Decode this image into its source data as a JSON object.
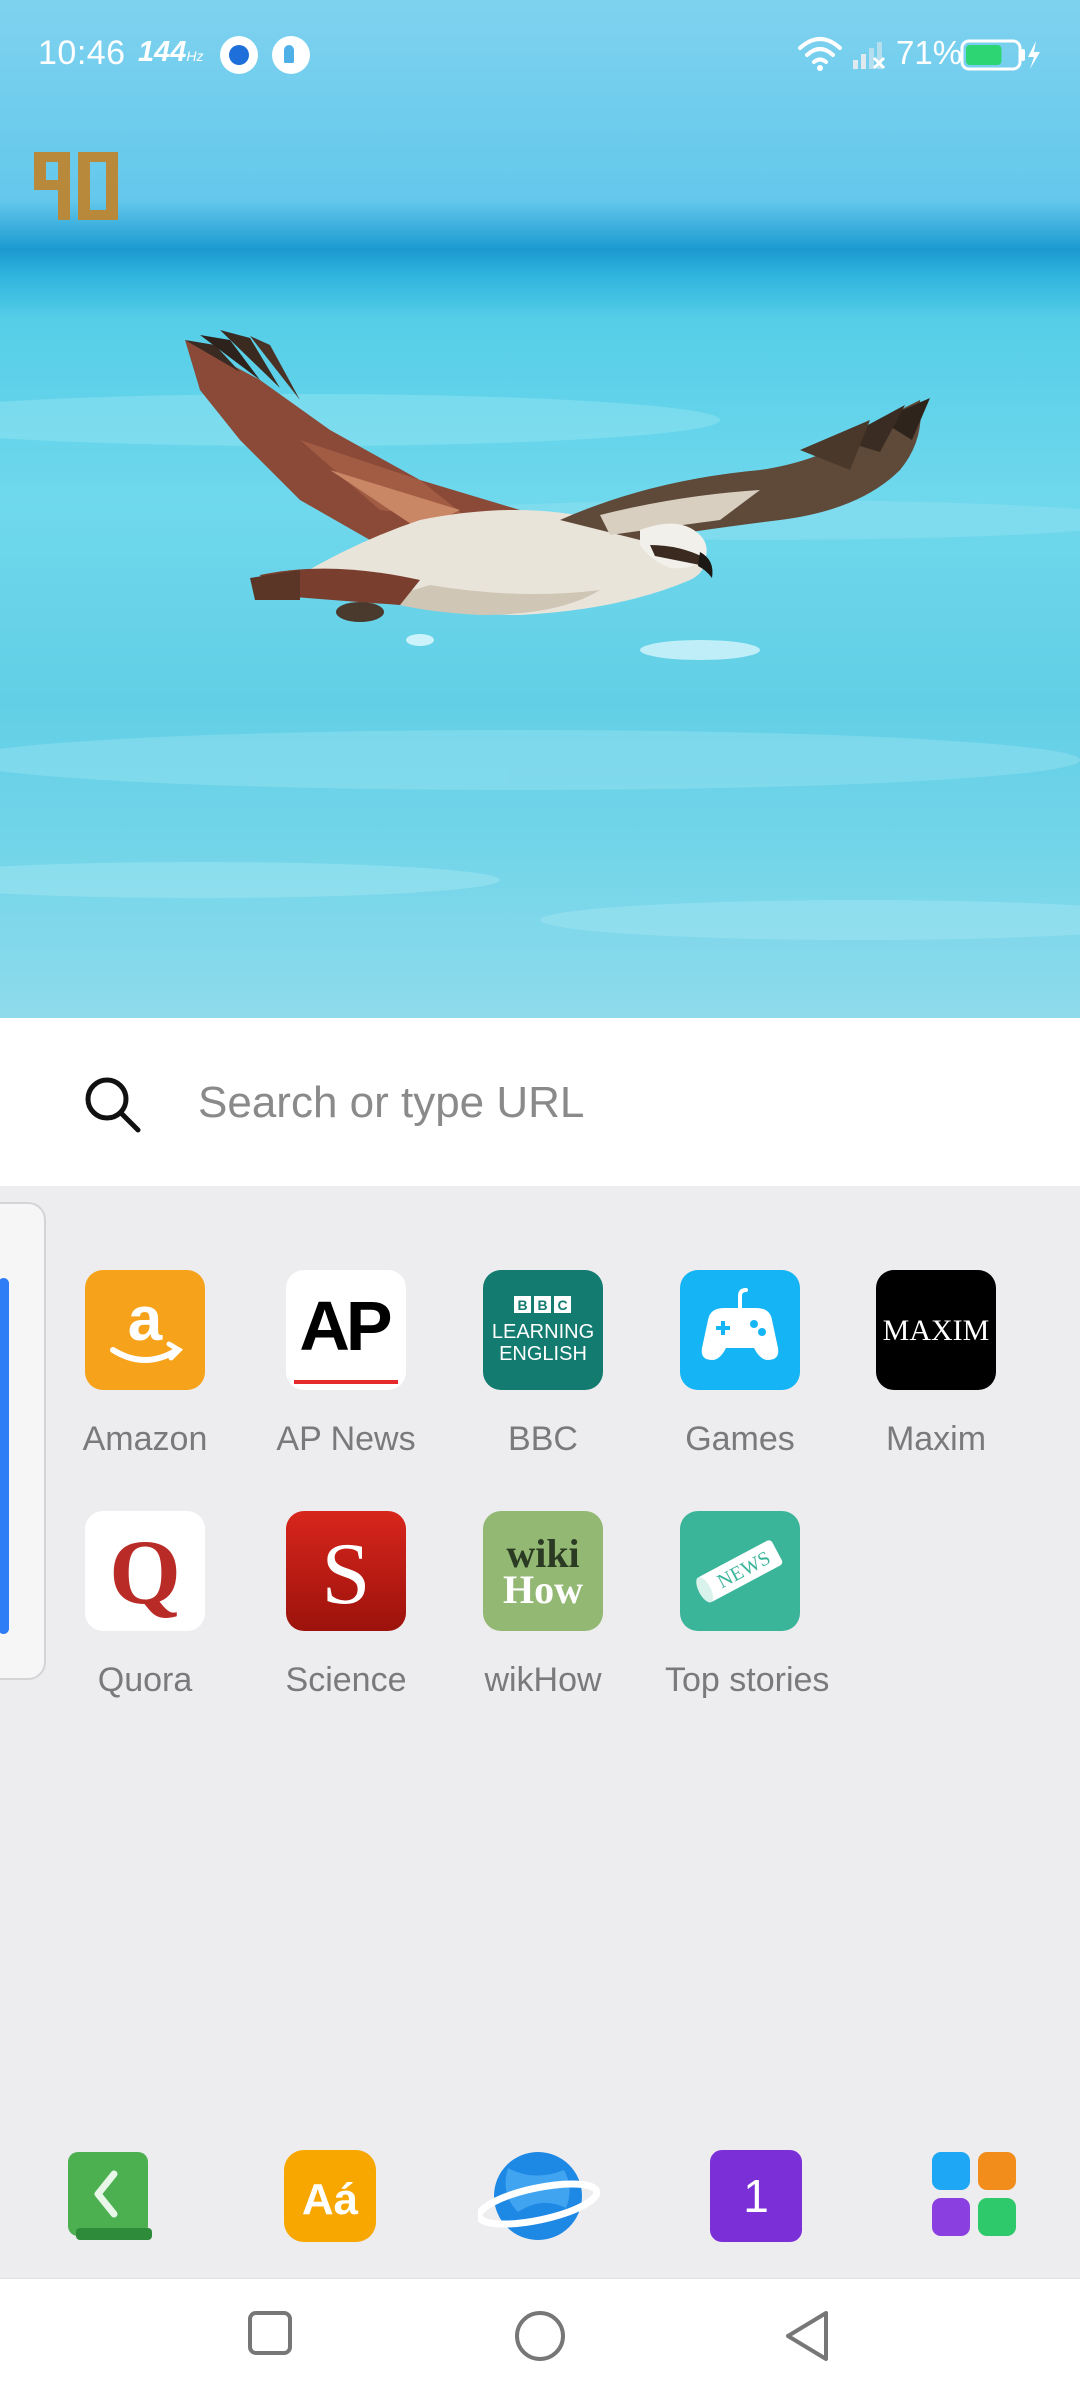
{
  "status_bar": {
    "time": "10:46",
    "refresh_rate": "144",
    "refresh_unit": "Hz",
    "battery_percent": "71%",
    "battery_level": 0.71
  },
  "brand": {
    "logo_text": "90"
  },
  "search": {
    "placeholder": "Search or type URL",
    "value": ""
  },
  "shortcuts": [
    {
      "label": "Amazon",
      "icon": "amazon-icon"
    },
    {
      "label": "AP News",
      "icon": "ap-news-icon"
    },
    {
      "label": "BBC",
      "icon": "bbc-learning-english-icon",
      "icon_text": [
        "BBC",
        "LEARNING",
        "ENGLISH"
      ]
    },
    {
      "label": "Games",
      "icon": "gamepad-icon"
    },
    {
      "label": "Maxim",
      "icon": "maxim-icon",
      "icon_text": "MAXIM"
    },
    {
      "label": "Quora",
      "icon": "quora-icon",
      "icon_text": "Q"
    },
    {
      "label": "Science",
      "icon": "science-icon",
      "icon_text": "S"
    },
    {
      "label": "wikHow",
      "icon": "wikihow-icon",
      "icon_text": [
        "wiki",
        "How"
      ]
    },
    {
      "label": "Top stories",
      "icon": "newspaper-icon",
      "icon_text": "NEWS"
    }
  ],
  "dock": [
    {
      "name": "back-book-app",
      "color": "#4caf50"
    },
    {
      "name": "dictionary-app",
      "color": "#f7a700",
      "icon_text": "Aá"
    },
    {
      "name": "browser-globe-app",
      "color": "#1e88e5"
    },
    {
      "name": "one-app",
      "color": "#7b2fd6",
      "icon_text": "1"
    },
    {
      "name": "app-drawer",
      "colors": [
        "#1ea7f5",
        "#f28c1a",
        "#8a3fe0",
        "#2ec96a"
      ]
    }
  ],
  "colors": {
    "accent": "#2e7cf6",
    "label_gray": "#7a7a7c",
    "background": "#ededef"
  }
}
